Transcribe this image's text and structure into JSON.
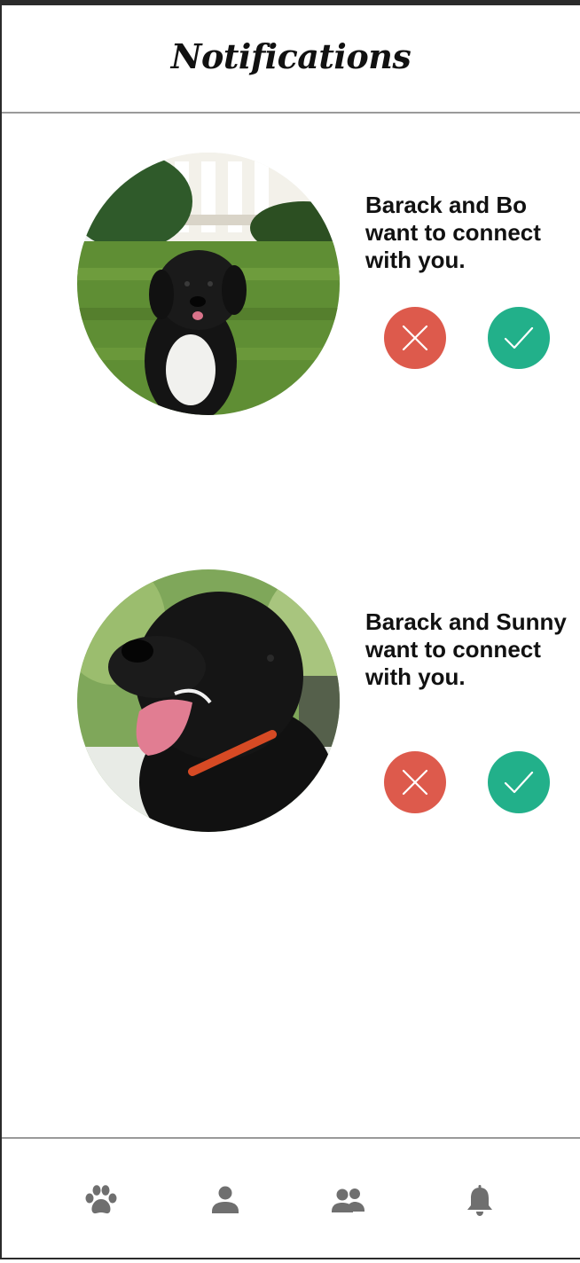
{
  "header": {
    "title": "Notifications"
  },
  "notifications": [
    {
      "message": "Barack and Bo want to connect with you.",
      "avatar_icon": "dog-photo-bo",
      "decline_icon": "close-icon",
      "accept_icon": "check-icon"
    },
    {
      "message": "Barack and Sunny want to connect with you.",
      "avatar_icon": "dog-photo-sunny",
      "decline_icon": "close-icon",
      "accept_icon": "check-icon"
    }
  ],
  "tabbar": {
    "items": [
      {
        "icon": "paw-icon"
      },
      {
        "icon": "person-icon"
      },
      {
        "icon": "people-icon"
      },
      {
        "icon": "bell-icon"
      }
    ]
  },
  "colors": {
    "decline": "#dd5a4c",
    "accept": "#22b08a",
    "tab_icon": "#6f6f6f",
    "divider": "#9a9a9a"
  }
}
